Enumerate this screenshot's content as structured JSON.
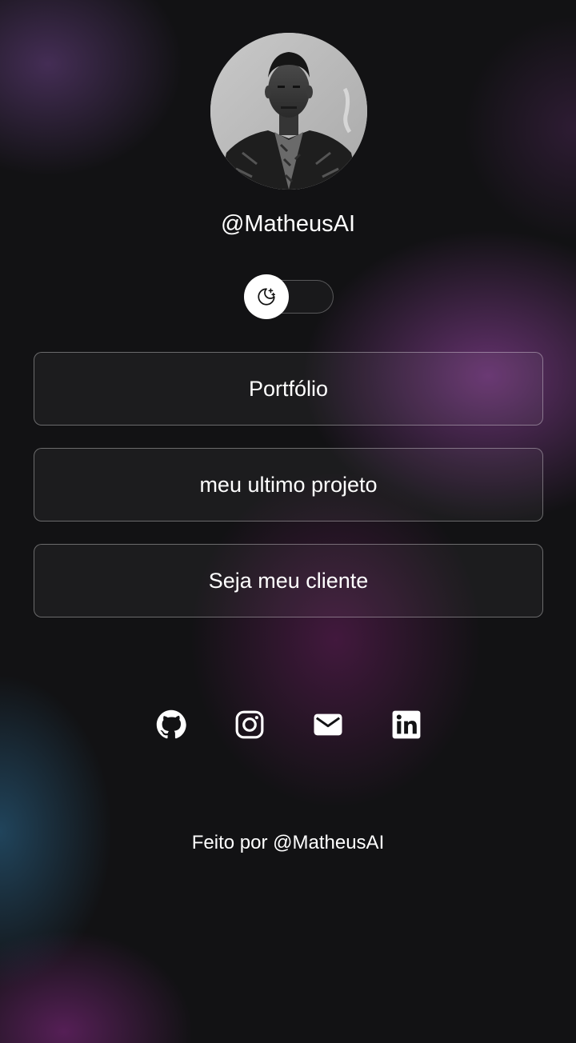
{
  "profile": {
    "username": "@MatheusAI",
    "avatar_alt": "profile-photo"
  },
  "theme_toggle": {
    "state": "dark",
    "icon": "moon-stars-icon"
  },
  "links": [
    {
      "label": "Portfólio"
    },
    {
      "label": "meu ultimo projeto"
    },
    {
      "label": "Seja meu cliente"
    }
  ],
  "socials": [
    {
      "icon": "github-icon"
    },
    {
      "icon": "instagram-icon"
    },
    {
      "icon": "mail-icon"
    },
    {
      "icon": "linkedin-icon"
    }
  ],
  "footer": {
    "text": "Feito por @MatheusAI"
  },
  "colors": {
    "background": "#121214",
    "accent_purple": "#803c8c",
    "accent_blue": "#285f82",
    "text": "#ffffff"
  }
}
